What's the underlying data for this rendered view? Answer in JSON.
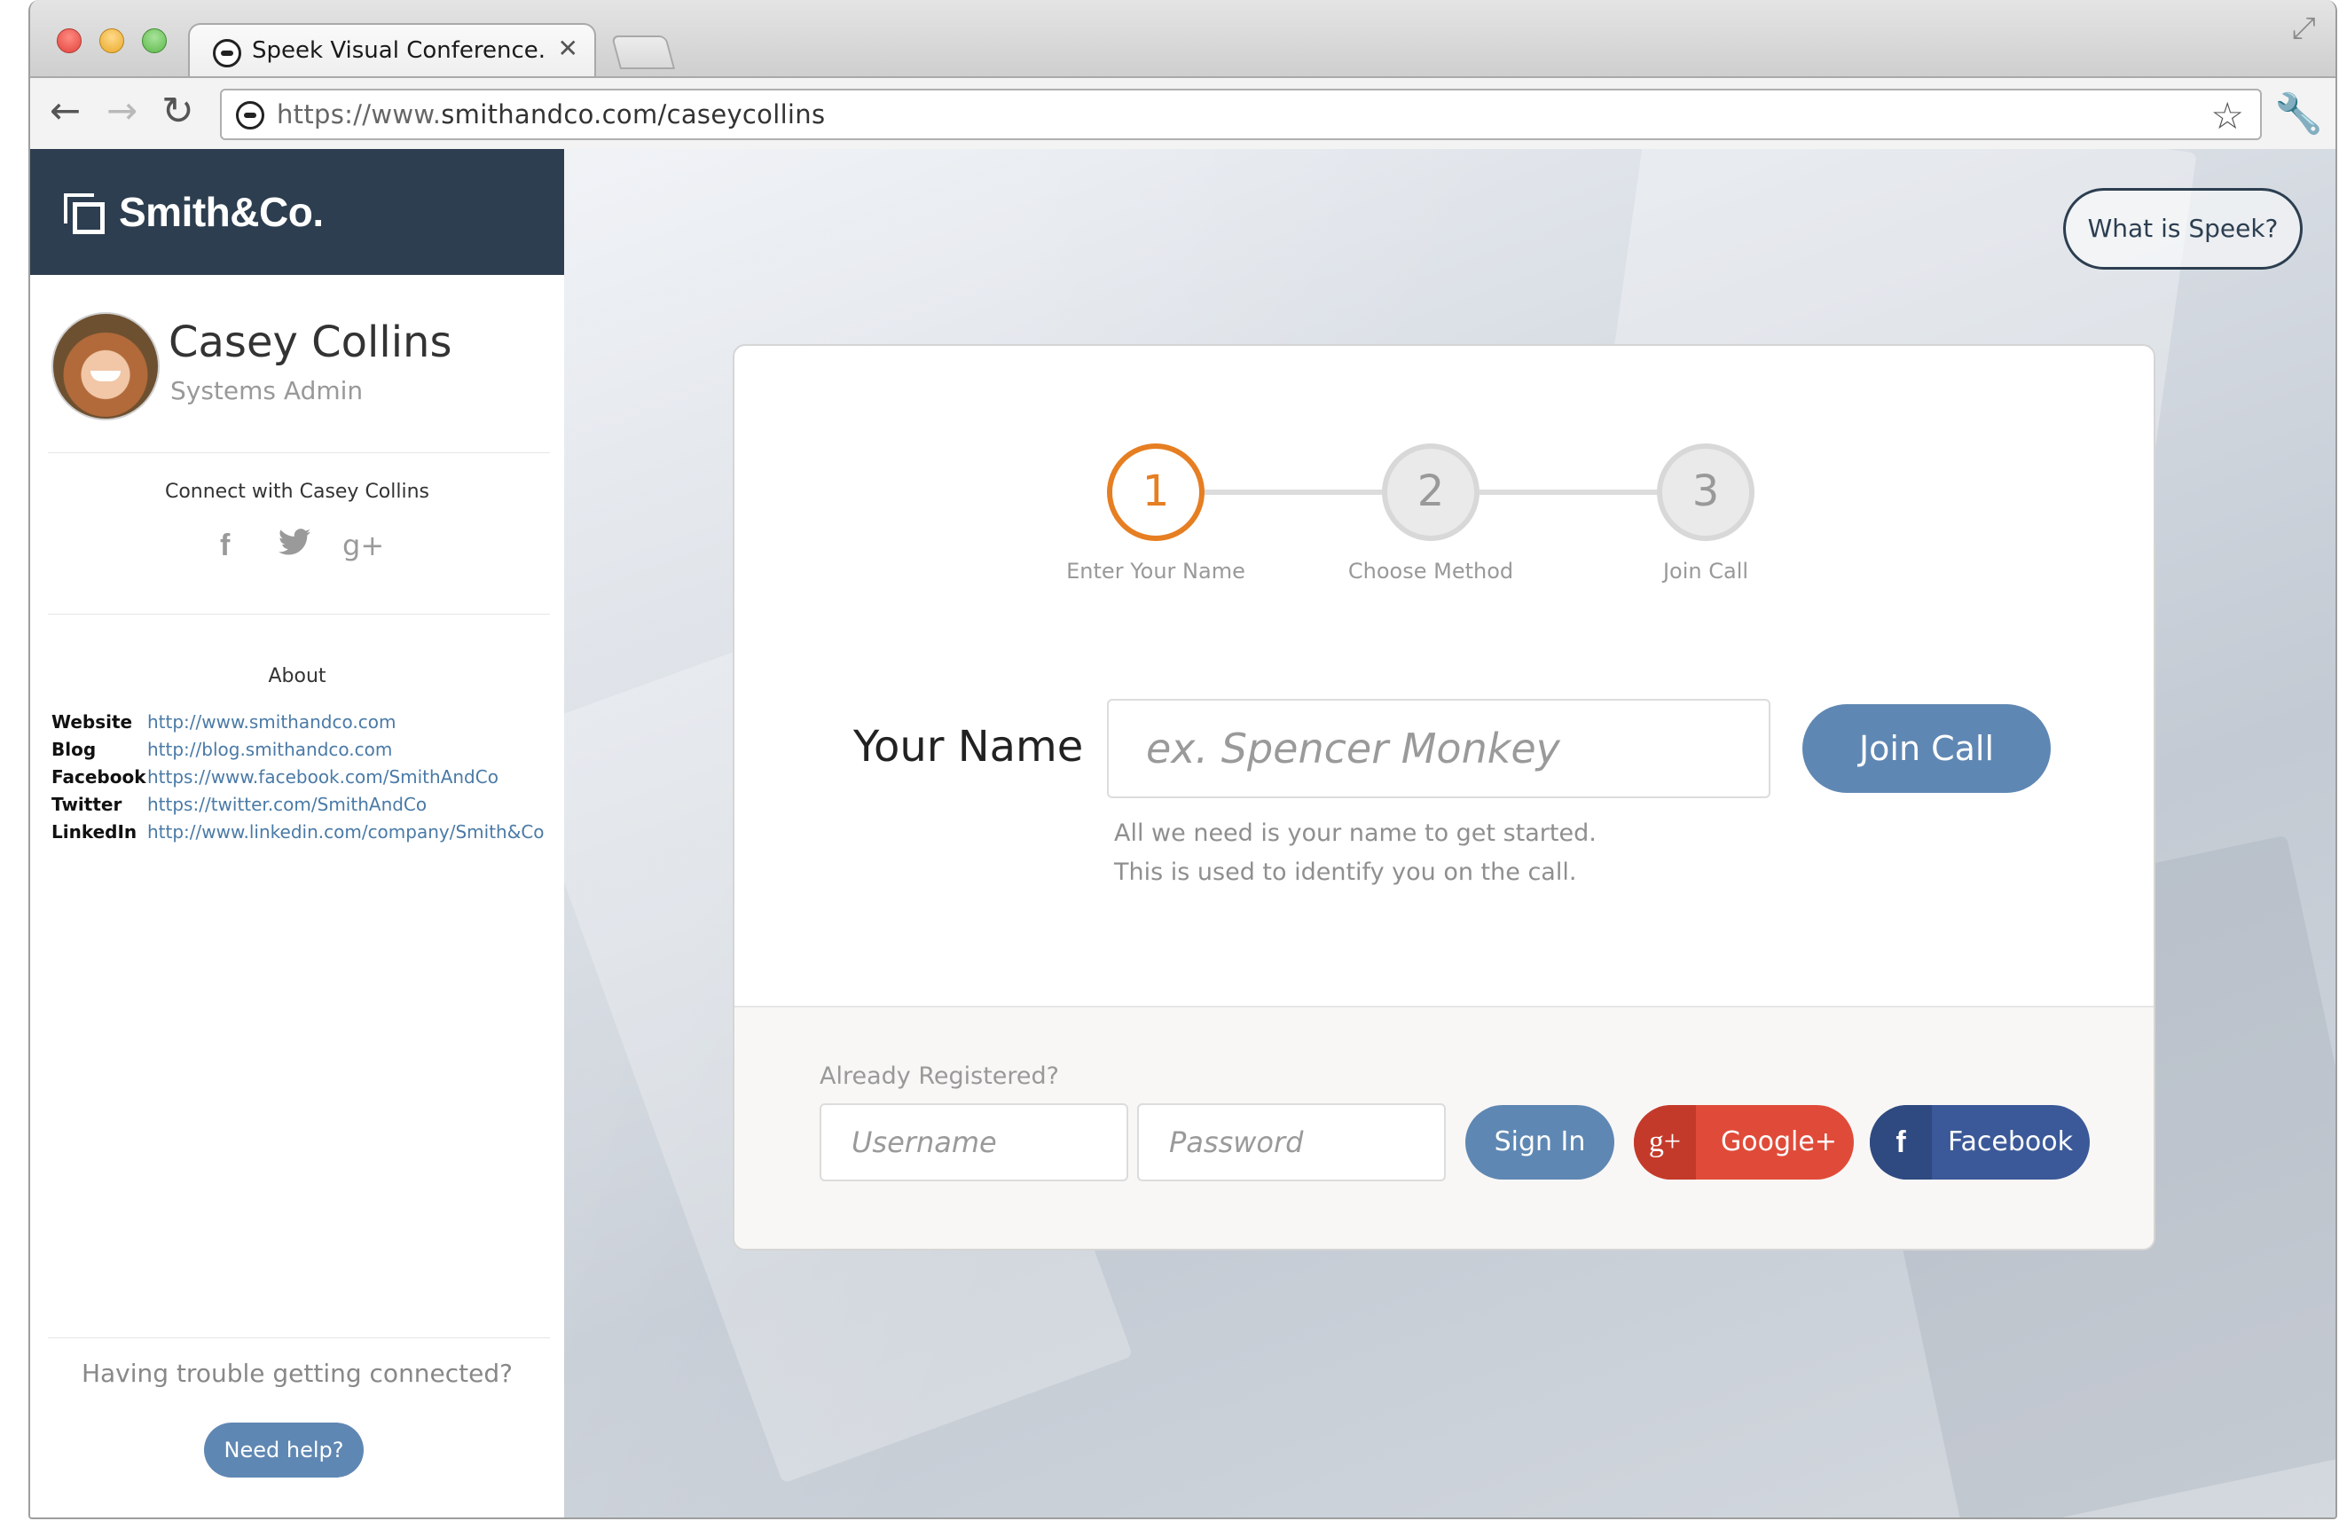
{
  "browser": {
    "tab_title": "Speek Visual Conference...",
    "tab_close": "✕",
    "url_scheme": "https://www.",
    "url_host": "smithandco.com",
    "url_path": "/caseycollins"
  },
  "sidebar": {
    "brand": "Smith&Co.",
    "profile": {
      "name": "Casey Collins",
      "role": "Systems Admin"
    },
    "connect_title": "Connect with Casey Collins",
    "social": {
      "facebook": "f",
      "twitter": "🐦",
      "google": "g+"
    },
    "about_title": "About",
    "links": [
      {
        "label": "Website",
        "url": "http://www.smithandco.com"
      },
      {
        "label": "Blog",
        "url": "http://blog.smithandco.com"
      },
      {
        "label": "Facebook",
        "url": "https://www.facebook.com/SmithAndCo"
      },
      {
        "label": "Twitter",
        "url": "https://twitter.com/SmithAndCo"
      },
      {
        "label": "LinkedIn",
        "url": "http://www.linkedin.com/company/Smith&Co"
      }
    ],
    "trouble_text": "Having trouble getting connected?",
    "help_button": "Need help?"
  },
  "main": {
    "what_button": "What is Speek?",
    "steps": [
      {
        "number": "1",
        "label": "Enter Your Name",
        "active": true
      },
      {
        "number": "2",
        "label": "Choose Method",
        "active": false
      },
      {
        "number": "3",
        "label": "Join Call",
        "active": false
      }
    ],
    "name_label": "Your Name",
    "name_placeholder": "ex. Spencer Monkey",
    "join_button": "Join Call",
    "hint_line1": "All we need is your name to get started.",
    "hint_line2": "This is used to identify you on the call.",
    "already_registered": "Already Registered?",
    "username_placeholder": "Username",
    "password_placeholder": "Password",
    "signin_button": "Sign In",
    "google_button": "Google+",
    "facebook_button": "Facebook"
  },
  "colors": {
    "brand_navy": "#2c3e50",
    "accent_orange": "#e67e22",
    "button_blue": "#5f87b3",
    "google_red": "#e04b39",
    "facebook_blue": "#3b5998"
  }
}
